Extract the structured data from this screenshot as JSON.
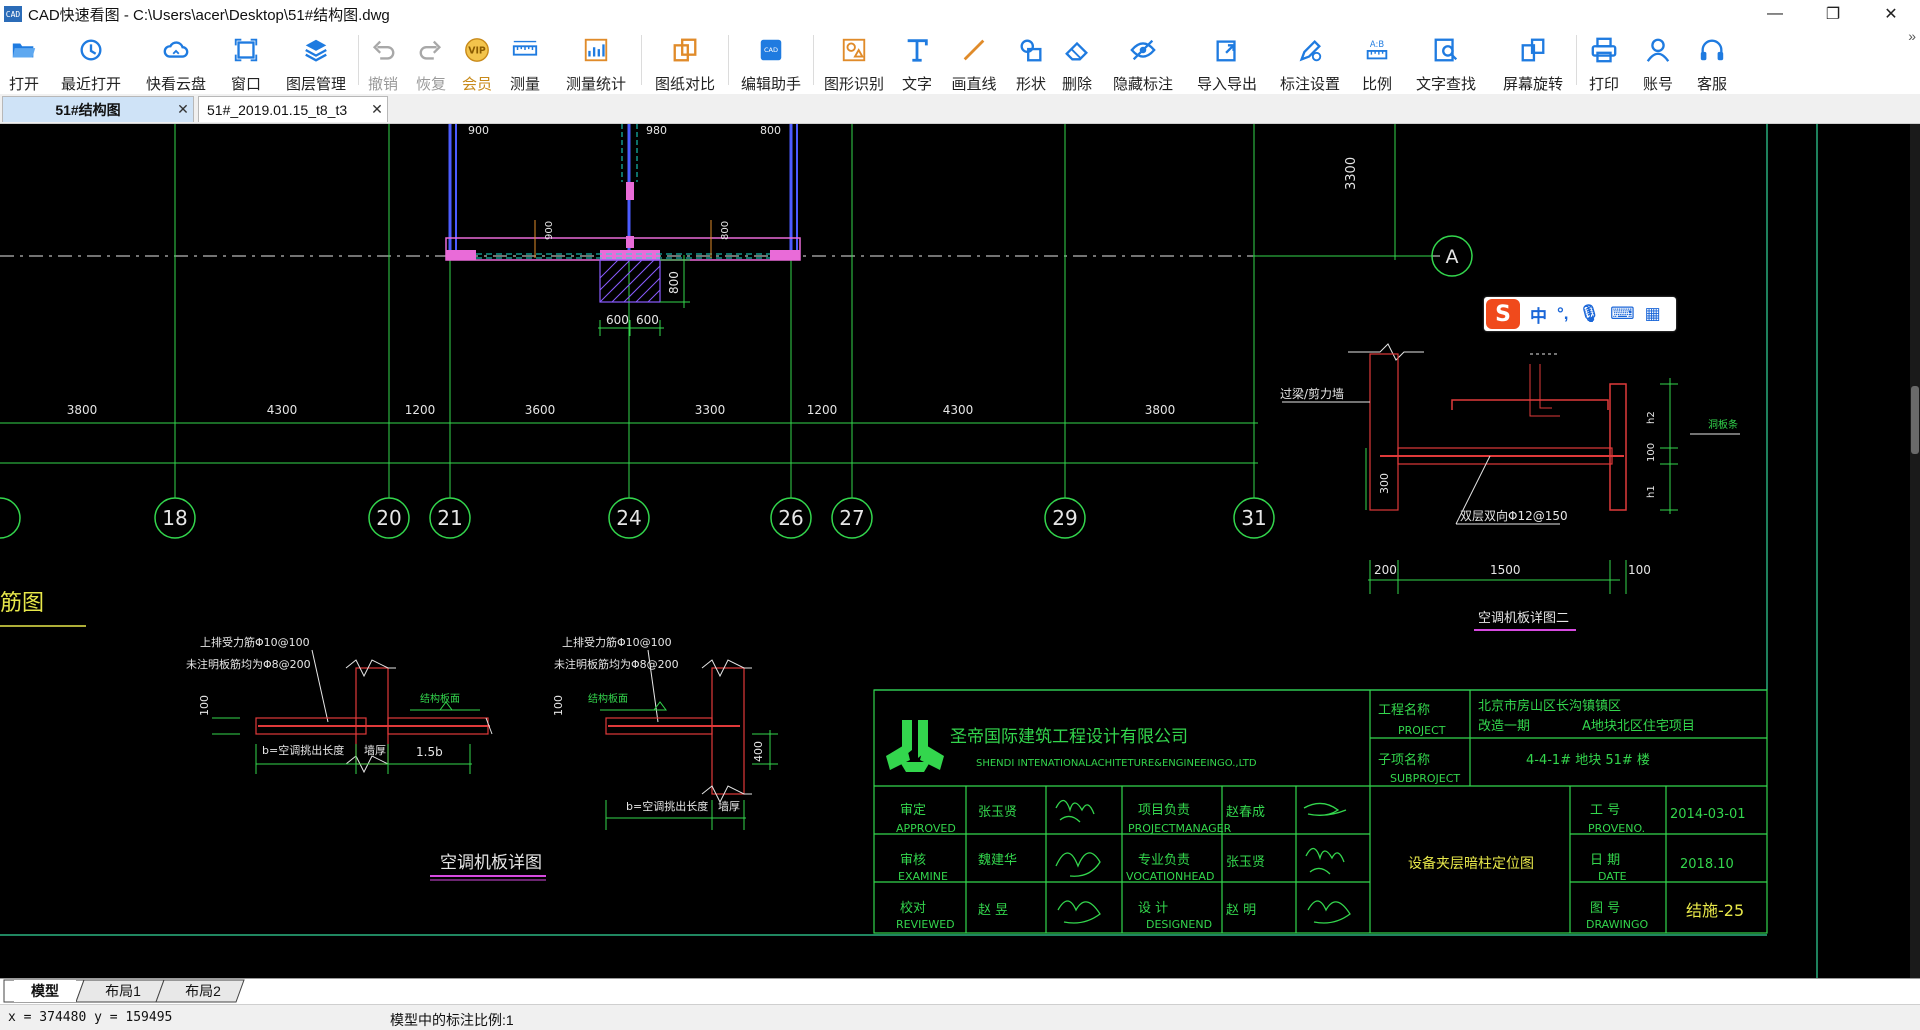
{
  "window": {
    "app_icon": "CAD",
    "title": "CAD快速看图 - C:\\Users\\acer\\Desktop\\51#结构图.dwg",
    "controls": [
      "—",
      "❐",
      "✕"
    ]
  },
  "toolbar": {
    "items": [
      {
        "label": "打开",
        "icon": "folder-open-icon",
        "state": "normal"
      },
      {
        "label": "最近打开",
        "icon": "history-icon",
        "state": "normal"
      },
      {
        "label": "快看云盘",
        "icon": "cloud-icon",
        "state": "normal"
      },
      {
        "label": "窗口",
        "icon": "window-icon",
        "state": "normal"
      },
      {
        "label": "图层管理",
        "icon": "layers-icon",
        "state": "normal"
      },
      {
        "label": "撤销",
        "icon": "undo-icon",
        "state": "disabled"
      },
      {
        "label": "恢复",
        "icon": "redo-icon",
        "state": "disabled"
      },
      {
        "label": "会员",
        "icon": "vip-icon",
        "state": "vip"
      },
      {
        "label": "测量",
        "icon": "ruler-icon",
        "state": "normal"
      },
      {
        "label": "测量统计",
        "icon": "measure-stats-icon",
        "state": "normal"
      },
      {
        "label": "图纸对比",
        "icon": "compare-icon",
        "state": "normal"
      },
      {
        "label": "编辑助手",
        "icon": "edit-assistant-icon",
        "state": "normal"
      },
      {
        "label": "图形识别",
        "icon": "shape-recognize-icon",
        "state": "normal"
      },
      {
        "label": "文字",
        "icon": "text-icon",
        "state": "normal"
      },
      {
        "label": "画直线",
        "icon": "line-icon",
        "state": "normal"
      },
      {
        "label": "形状",
        "icon": "shapes-icon",
        "state": "normal"
      },
      {
        "label": "删除",
        "icon": "eraser-icon",
        "state": "normal"
      },
      {
        "label": "隐藏标注",
        "icon": "hide-eye-icon",
        "state": "normal"
      },
      {
        "label": "导入导出",
        "icon": "import-export-icon",
        "state": "normal"
      },
      {
        "label": "标注设置",
        "icon": "annotation-settings-icon",
        "state": "normal"
      },
      {
        "label": "比例",
        "icon": "scale-icon",
        "state": "normal"
      },
      {
        "label": "文字查找",
        "icon": "text-search-icon",
        "state": "normal"
      },
      {
        "label": "屏幕旋转",
        "icon": "rotate-icon",
        "state": "normal"
      },
      {
        "label": "打印",
        "icon": "print-icon",
        "state": "normal"
      },
      {
        "label": "账号",
        "icon": "account-icon",
        "state": "normal"
      },
      {
        "label": "客服",
        "icon": "headset-icon",
        "state": "normal"
      }
    ],
    "vip_badge": "VIP",
    "overflow": "»"
  },
  "tabs": [
    {
      "label": "51#结构图",
      "close": "✕",
      "active": true
    },
    {
      "label": "51#_2019.01.15_t8_t3",
      "close": "✕",
      "active": false
    }
  ],
  "ime": {
    "logo": "S",
    "items": [
      "中",
      "°,",
      "🎙",
      "⌨",
      "▦"
    ]
  },
  "drawing": {
    "top_dims": [
      "900",
      "980",
      "800"
    ],
    "small_dims_vertical": [
      "900",
      "800"
    ],
    "dim_800": "800",
    "dim_600a": "600",
    "dim_600b": "600",
    "dim_3300": "3300",
    "axis_a": "A",
    "spans": [
      "3800",
      "4300",
      "1200",
      "3600",
      "3300",
      "1200",
      "4300",
      "3800"
    ],
    "axes": [
      "18",
      "20",
      "21",
      "24",
      "26",
      "27",
      "29",
      "31"
    ],
    "section_title_left": "筋图",
    "detail1": {
      "note1": "上排受力筋Φ10@100",
      "note2": "未注明板筋均为Φ8@200",
      "top_label": "结构板面",
      "dim_100": "100",
      "b_label": "b=空调挑出长度",
      "wall": "墙厚",
      "dim_15b": "1.5b"
    },
    "detail2": {
      "note1": "上排受力筋Φ10@100",
      "note2": "未注明板筋均为Φ8@200",
      "top_label": "结构板面",
      "dim_100": "100",
      "dim_400": "400",
      "b_label": "b=空调挑出长度",
      "wall": "墙厚"
    },
    "detail_caption": "空调机板详图",
    "detail2_right": {
      "beam_label": "过梁/剪力墙",
      "rebar": "双层双向Φ12@150",
      "note_right": "洞板条",
      "h2": "h2",
      "h1": "h1",
      "d100": "100",
      "d300": "300",
      "d200": "200",
      "d1500": "1500",
      "d100b": "100",
      "caption": "空调机板详图二"
    },
    "titleblock": {
      "company_cn": "圣帝国际建筑工程设计有限公司",
      "company_en": "SHENDI INTENATIONALACHITETURE&ENGINEEINGO.,LTD",
      "project_label": "工程名称",
      "project_en": "PROJECT",
      "project_name1": "北京市房山区长沟镇镇区",
      "project_name2": "改造一期",
      "project_name3": "A地块北区住宅项目",
      "sub_label": "子项名称",
      "sub_en": "SUBPROJECT",
      "sub_name": "4-4-1# 地块  51# 楼",
      "approved": "审定",
      "approved_en": "APPROVED",
      "approved_name": "张玉贤",
      "examine": "审核",
      "examine_en": "EXAMINE",
      "examine_name": "魏建华",
      "reviewed": "校对",
      "reviewed_en": "REVIEWED",
      "reviewed_name": "赵  昱",
      "pm": "项目负责",
      "pm_en": "PROJECTMANAGER",
      "pm_name": "赵春成",
      "vocation": "专业负责",
      "vocation_en": "VOCATIONHEAD",
      "vocation_name": "张玉贤",
      "design": "设  计",
      "design_en": "DESIGNEND",
      "design_name": "赵  明",
      "drawing_title": "设备夹层暗柱定位图",
      "proj_no": "工  号",
      "proj_no_en": "PROVENO.",
      "proj_no_val": "2014-03-01",
      "date": "日  期",
      "date_en": "DATE",
      "date_val": "2018.10",
      "drawing_no": "图  号",
      "drawing_no_en": "DRAWINGO",
      "drawing_no_val": "结施-25"
    }
  },
  "layout_tabs": [
    "模型",
    "布局1",
    "布局2"
  ],
  "status": {
    "coords": "x = 374480 y = 159495",
    "scale": "模型中的标注比例:1"
  }
}
